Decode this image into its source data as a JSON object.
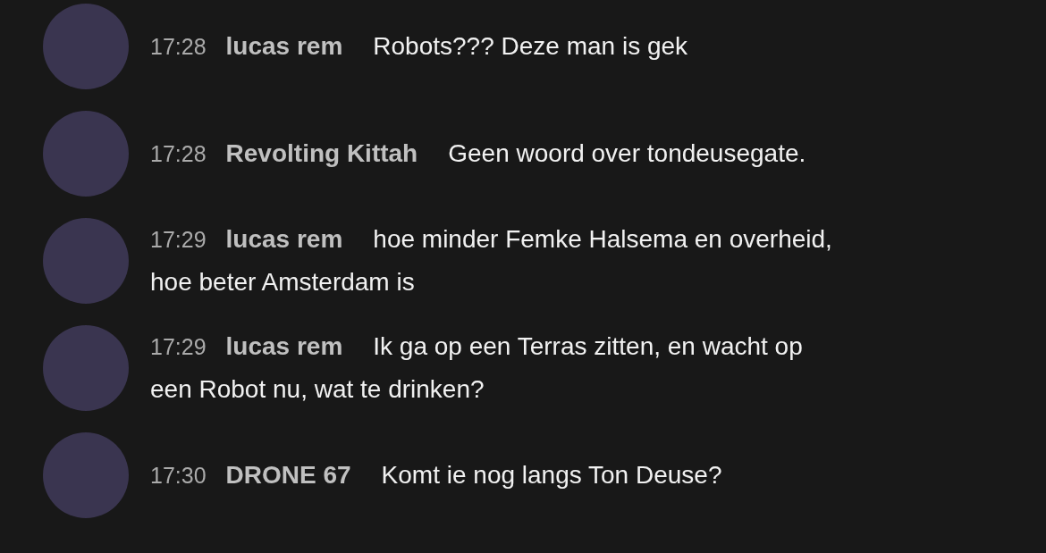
{
  "messages": [
    {
      "time": "17:28",
      "author": "lucas rem",
      "lines": [
        "Robots??? Deze man is gek"
      ]
    },
    {
      "time": "17:28",
      "author": "Revolting Kittah",
      "lines": [
        "Geen woord over tondeusegate."
      ]
    },
    {
      "time": "17:29",
      "author": "lucas rem",
      "lines": [
        "hoe minder Femke Halsema en overheid,",
        "hoe beter Amsterdam is"
      ]
    },
    {
      "time": "17:29",
      "author": "lucas rem",
      "lines": [
        "Ik ga op een Terras zitten, en wacht op",
        "een Robot nu, wat te drinken?"
      ]
    },
    {
      "time": "17:30",
      "author": "DRONE 67",
      "lines": [
        "Komt ie nog langs Ton Deuse?"
      ]
    }
  ]
}
